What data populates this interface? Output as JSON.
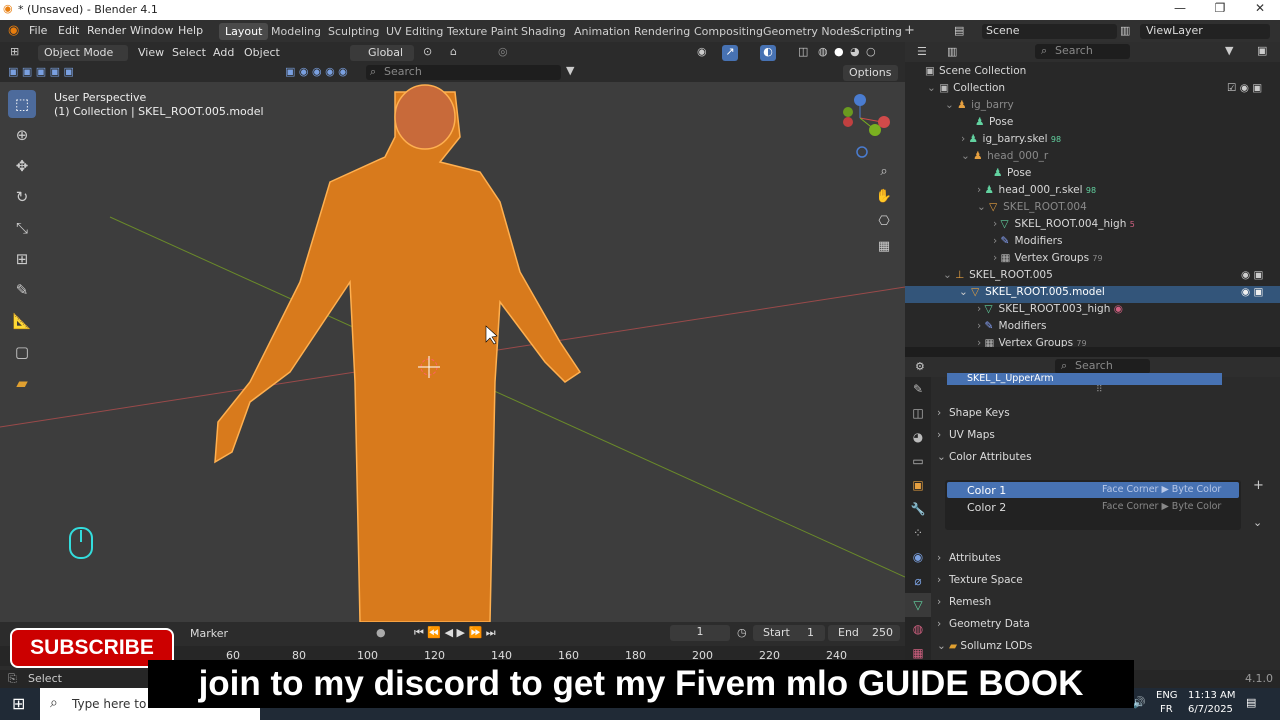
{
  "window": {
    "title": "* (Unsaved) - Blender 4.1",
    "minimize": "—",
    "maximize": "❐",
    "close": "✕"
  },
  "menu": [
    "File",
    "Edit",
    "Render",
    "Window",
    "Help"
  ],
  "workspaces": [
    "Layout",
    "Modeling",
    "Sculpting",
    "UV Editing",
    "Texture Paint",
    "Shading",
    "Animation",
    "Rendering",
    "Compositing",
    "Geometry Nodes",
    "Scripting"
  ],
  "active_workspace": "Layout",
  "scene": {
    "label": "Scene",
    "view_layer": "ViewLayer"
  },
  "viewport_header": {
    "mode": "Object Mode",
    "view": "View",
    "select": "Select",
    "add": "Add",
    "object": "Object",
    "orientation": "Global",
    "search_placeholder": "Search",
    "options": "Options"
  },
  "viewport": {
    "perspective": "User Perspective",
    "collection_label": "(1) Collection | SKEL_ROOT.005.model"
  },
  "outliner": {
    "search_placeholder": "Search",
    "rows": [
      {
        "label": "Scene Collection",
        "icon": "▣"
      },
      {
        "label": "Collection",
        "icon": "▣"
      },
      {
        "label": "ig_barry",
        "icon": "♟"
      },
      {
        "label": "Pose",
        "icon": "♟"
      },
      {
        "label": "ig_barry.skel",
        "icon": "♟",
        "badge": "98"
      },
      {
        "label": "head_000_r",
        "icon": "♟"
      },
      {
        "label": "Pose",
        "icon": "♟"
      },
      {
        "label": "head_000_r.skel",
        "icon": "♟",
        "badge": "98"
      },
      {
        "label": "SKEL_ROOT.004",
        "icon": "▽"
      },
      {
        "label": "SKEL_ROOT.004_high",
        "icon": "▽",
        "badge": "5"
      },
      {
        "label": "Modifiers",
        "icon": "🔧"
      },
      {
        "label": "Vertex Groups",
        "icon": "▦",
        "badge": "79"
      },
      {
        "label": "SKEL_ROOT.005",
        "icon": "⊥"
      },
      {
        "label": "SKEL_ROOT.005.model",
        "icon": "▽"
      },
      {
        "label": "SKEL_ROOT.003_high",
        "icon": "▽"
      },
      {
        "label": "Modifiers",
        "icon": "🔧"
      },
      {
        "label": "Vertex Groups",
        "icon": "▦",
        "badge": "79"
      }
    ]
  },
  "properties": {
    "search_placeholder": "Search",
    "active_vgroup": "SKEL_L_UpperArm",
    "sections": [
      "Shape Keys",
      "UV Maps",
      "Color Attributes",
      "Attributes",
      "Texture Space",
      "Remesh",
      "Geometry Data",
      "Sollumz LODs"
    ],
    "color_attributes": [
      {
        "name": "Color 1",
        "domain": "Face Corner ▶ Byte Color"
      },
      {
        "name": "Color 2",
        "domain": "Face Corner ▶ Byte Color"
      }
    ]
  },
  "timeline": {
    "marker": "Marker",
    "current_frame": "1",
    "start_label": "Start",
    "start": "1",
    "end_label": "End",
    "end": "250",
    "ticks": [
      "60",
      "80",
      "100",
      "120",
      "140",
      "160",
      "180",
      "200",
      "220",
      "240"
    ]
  },
  "status": {
    "left": "Select",
    "version": "4.1.0"
  },
  "overlay": {
    "subscribe": "SUBSCRIBE",
    "caption": "join to my discord to get my Fivem mlo GUIDE BOOK"
  },
  "taskbar": {
    "search_placeholder": "Type here to",
    "lang": "ENG",
    "layout": "FR",
    "time": "11:13 AM",
    "date": "6/7/2025"
  }
}
